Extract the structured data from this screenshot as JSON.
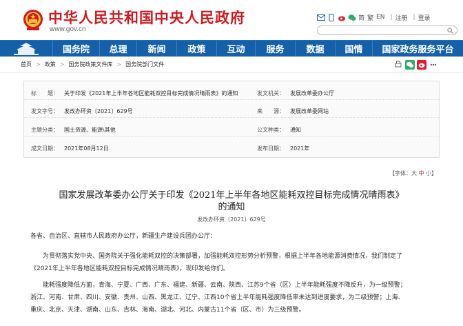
{
  "header": {
    "site_name": "中华人民共和国中央人民政府",
    "site_url": "www.gov.cn",
    "links": [
      "简",
      "繁",
      "EN",
      "登录",
      "注册"
    ],
    "brand_color": "#d0191e"
  },
  "nav": {
    "items": [
      "国务院",
      "总理",
      "新闻",
      "政策",
      "互动",
      "服务",
      "数据",
      "国情",
      "国家政务服务平台"
    ],
    "color": "#1560a9"
  },
  "breadcrumb": [
    "首页",
    "政策",
    "国务院政策文件库",
    "国务院部门文件"
  ],
  "info": {
    "title_label": "标　　题：",
    "title_value": "关于印发《2021年上半年各地区能耗双控目标完成情况晴雨表》的通知",
    "issuer_label": "发文机关：",
    "issuer_value": "发展改革委办公厅",
    "docno_label": "发文字号：",
    "docno_value": "发改办环资〔2021〕629号",
    "source_label": "来　　源：",
    "source_value": "发展改革委网站",
    "topic_label": "主题分类：",
    "topic_value": "国土资源、能源\\其他",
    "type_label": "公文种类：",
    "type_value": "通知",
    "date_label": "成文日期：",
    "date_value": "2021年08月12日",
    "pub_label": "发布日期：",
    "pub_value": "2021年"
  },
  "fontsize": {
    "prefix": "【字体：",
    "big": "大",
    "mid": "中",
    "small": "小",
    "suffix": "】"
  },
  "article": {
    "title_line1": "国家发展改革委办公厅关于印发《2021年上半年各地区能耗双控目标完成情况晴雨表》",
    "title_line2": "的通知",
    "doc_number": "发改办环资〔2021〕629号",
    "salutation": "各省、自治区、直辖市人民政府办公厅，新疆生产建设兵团办公厅：",
    "p1_line1": "为贯彻落实党中央、国务院关于强化能耗双控的决策部署，加强能耗双控形势分析预警，根据上半年各地能源消费情况，我们制定了",
    "p1_line2": "《2021年上半年各地区能耗双控目标完成情况晴雨表》，现印发给你们。",
    "p2_line1": "能耗强度降低方面，青海、宁夏、广西、广东、福建、新疆、云南、陕西、江苏9个省（区）上半年能耗强度不降反升，为一级预警；",
    "p2_line2": "浙江、河南、甘肃、四川、安徽、贵州、山西、黑龙江、辽宁、江西10个省上半年能耗强度降低率未达到进度要求，为二级预警；上海、",
    "p2_line3": "重庆、北京、天津、湖南、山东、吉林、海南、湖北、河北、内蒙古11个省（区、市）为三级预警。"
  }
}
